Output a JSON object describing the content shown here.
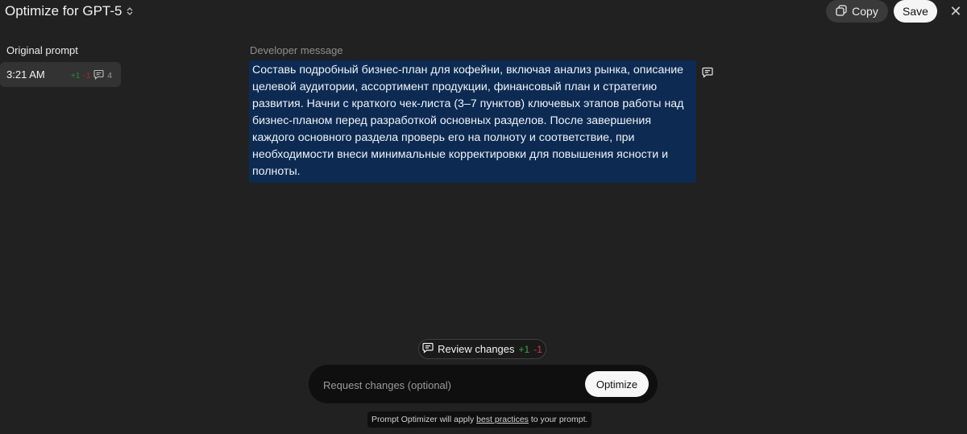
{
  "header": {
    "title": "Optimize for GPT-5",
    "copy_label": "Copy",
    "save_label": "Save",
    "close_symbol": "✕"
  },
  "sidebar": {
    "heading": "Original prompt",
    "versions": [
      {
        "time": "3:21 AM",
        "added": "+1",
        "removed": "-1",
        "comments": "4"
      }
    ]
  },
  "editor": {
    "label": "Developer message",
    "text": "Составь подробный бизнес-план для кофейни, включая анализ рынка, описание целевой аудитории, ассортимент продукции, финансовый план и стратегию развития. Начни с краткого чек-листа (3–7 пунктов) ключевых этапов работы над бизнес-планом перед разработкой основных разделов. После завершения каждого основного раздела проверь его на полноту и соответствие, при необходимости внеси минимальные корректировки для повышения ясности и полноты."
  },
  "review": {
    "label": "Review changes",
    "added": "+1",
    "removed": "-1"
  },
  "request": {
    "placeholder": "Request changes (optional)",
    "optimize_label": "Optimize"
  },
  "footer": {
    "before": "Prompt Optimizer will apply ",
    "link": "best practices",
    "after": " to your prompt."
  },
  "colors": {
    "background": "#212121",
    "highlight": "#0d2b52",
    "added": "#35a64b",
    "removed": "#d23b3b"
  }
}
